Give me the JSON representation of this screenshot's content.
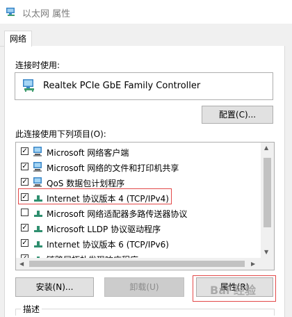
{
  "window": {
    "title": "以太网 属性"
  },
  "tabs": [
    {
      "label": "网络"
    }
  ],
  "connect_using_label": "连接时使用:",
  "adapter_name": "Realtek PCIe GbE Family Controller",
  "configure_button": "配置(C)...",
  "items_label": "此连接使用下列项目(O):",
  "items": [
    {
      "label": "Microsoft 网络客户端",
      "checked": true,
      "icon": "network-client-icon"
    },
    {
      "label": "Microsoft 网络的文件和打印机共享",
      "checked": true,
      "icon": "file-sharing-icon"
    },
    {
      "label": "QoS 数据包计划程序",
      "checked": true,
      "icon": "qos-icon"
    },
    {
      "label": "Internet 协议版本 4 (TCP/IPv4)",
      "checked": true,
      "icon": "protocol-icon"
    },
    {
      "label": "Microsoft 网络适配器多路传送器协议",
      "checked": false,
      "icon": "protocol-icon"
    },
    {
      "label": "Microsoft LLDP 协议驱动程序",
      "checked": true,
      "icon": "protocol-icon"
    },
    {
      "label": "Internet 协议版本 6 (TCP/IPv6)",
      "checked": true,
      "icon": "protocol-icon"
    },
    {
      "label": "链路层拓扑发现响应程序",
      "checked": true,
      "icon": "protocol-icon"
    }
  ],
  "buttons": {
    "install": "安装(N)...",
    "uninstall": "卸载(U)",
    "properties": "属性(R)"
  },
  "description_label": "描述",
  "watermark": "Bai 经验",
  "colors": {
    "highlight": "#e24848",
    "protocol_icon": "#2f8f6f"
  }
}
